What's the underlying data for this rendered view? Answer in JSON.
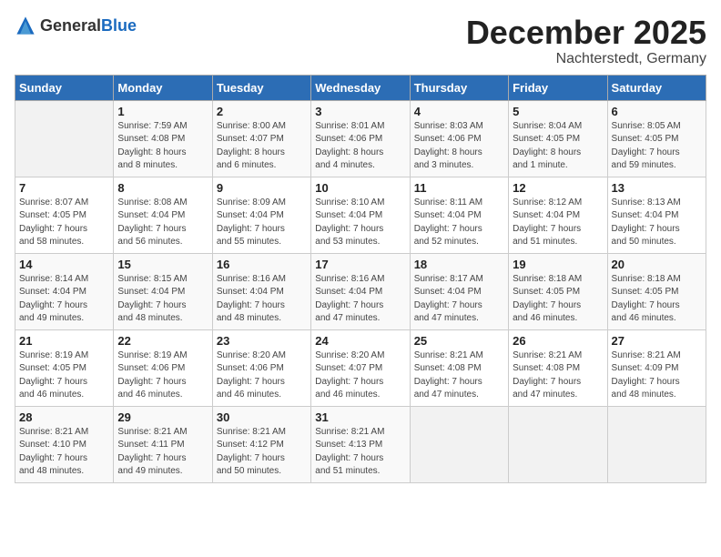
{
  "header": {
    "logo_general": "General",
    "logo_blue": "Blue",
    "month": "December 2025",
    "location": "Nachterstedt, Germany"
  },
  "calendar": {
    "days_of_week": [
      "Sunday",
      "Monday",
      "Tuesday",
      "Wednesday",
      "Thursday",
      "Friday",
      "Saturday"
    ],
    "weeks": [
      [
        {
          "day": "",
          "info": ""
        },
        {
          "day": "1",
          "info": "Sunrise: 7:59 AM\nSunset: 4:08 PM\nDaylight: 8 hours\nand 8 minutes."
        },
        {
          "day": "2",
          "info": "Sunrise: 8:00 AM\nSunset: 4:07 PM\nDaylight: 8 hours\nand 6 minutes."
        },
        {
          "day": "3",
          "info": "Sunrise: 8:01 AM\nSunset: 4:06 PM\nDaylight: 8 hours\nand 4 minutes."
        },
        {
          "day": "4",
          "info": "Sunrise: 8:03 AM\nSunset: 4:06 PM\nDaylight: 8 hours\nand 3 minutes."
        },
        {
          "day": "5",
          "info": "Sunrise: 8:04 AM\nSunset: 4:05 PM\nDaylight: 8 hours\nand 1 minute."
        },
        {
          "day": "6",
          "info": "Sunrise: 8:05 AM\nSunset: 4:05 PM\nDaylight: 7 hours\nand 59 minutes."
        }
      ],
      [
        {
          "day": "7",
          "info": "Sunrise: 8:07 AM\nSunset: 4:05 PM\nDaylight: 7 hours\nand 58 minutes."
        },
        {
          "day": "8",
          "info": "Sunrise: 8:08 AM\nSunset: 4:04 PM\nDaylight: 7 hours\nand 56 minutes."
        },
        {
          "day": "9",
          "info": "Sunrise: 8:09 AM\nSunset: 4:04 PM\nDaylight: 7 hours\nand 55 minutes."
        },
        {
          "day": "10",
          "info": "Sunrise: 8:10 AM\nSunset: 4:04 PM\nDaylight: 7 hours\nand 53 minutes."
        },
        {
          "day": "11",
          "info": "Sunrise: 8:11 AM\nSunset: 4:04 PM\nDaylight: 7 hours\nand 52 minutes."
        },
        {
          "day": "12",
          "info": "Sunrise: 8:12 AM\nSunset: 4:04 PM\nDaylight: 7 hours\nand 51 minutes."
        },
        {
          "day": "13",
          "info": "Sunrise: 8:13 AM\nSunset: 4:04 PM\nDaylight: 7 hours\nand 50 minutes."
        }
      ],
      [
        {
          "day": "14",
          "info": "Sunrise: 8:14 AM\nSunset: 4:04 PM\nDaylight: 7 hours\nand 49 minutes."
        },
        {
          "day": "15",
          "info": "Sunrise: 8:15 AM\nSunset: 4:04 PM\nDaylight: 7 hours\nand 48 minutes."
        },
        {
          "day": "16",
          "info": "Sunrise: 8:16 AM\nSunset: 4:04 PM\nDaylight: 7 hours\nand 48 minutes."
        },
        {
          "day": "17",
          "info": "Sunrise: 8:16 AM\nSunset: 4:04 PM\nDaylight: 7 hours\nand 47 minutes."
        },
        {
          "day": "18",
          "info": "Sunrise: 8:17 AM\nSunset: 4:04 PM\nDaylight: 7 hours\nand 47 minutes."
        },
        {
          "day": "19",
          "info": "Sunrise: 8:18 AM\nSunset: 4:05 PM\nDaylight: 7 hours\nand 46 minutes."
        },
        {
          "day": "20",
          "info": "Sunrise: 8:18 AM\nSunset: 4:05 PM\nDaylight: 7 hours\nand 46 minutes."
        }
      ],
      [
        {
          "day": "21",
          "info": "Sunrise: 8:19 AM\nSunset: 4:05 PM\nDaylight: 7 hours\nand 46 minutes."
        },
        {
          "day": "22",
          "info": "Sunrise: 8:19 AM\nSunset: 4:06 PM\nDaylight: 7 hours\nand 46 minutes."
        },
        {
          "day": "23",
          "info": "Sunrise: 8:20 AM\nSunset: 4:06 PM\nDaylight: 7 hours\nand 46 minutes."
        },
        {
          "day": "24",
          "info": "Sunrise: 8:20 AM\nSunset: 4:07 PM\nDaylight: 7 hours\nand 46 minutes."
        },
        {
          "day": "25",
          "info": "Sunrise: 8:21 AM\nSunset: 4:08 PM\nDaylight: 7 hours\nand 47 minutes."
        },
        {
          "day": "26",
          "info": "Sunrise: 8:21 AM\nSunset: 4:08 PM\nDaylight: 7 hours\nand 47 minutes."
        },
        {
          "day": "27",
          "info": "Sunrise: 8:21 AM\nSunset: 4:09 PM\nDaylight: 7 hours\nand 48 minutes."
        }
      ],
      [
        {
          "day": "28",
          "info": "Sunrise: 8:21 AM\nSunset: 4:10 PM\nDaylight: 7 hours\nand 48 minutes."
        },
        {
          "day": "29",
          "info": "Sunrise: 8:21 AM\nSunset: 4:11 PM\nDaylight: 7 hours\nand 49 minutes."
        },
        {
          "day": "30",
          "info": "Sunrise: 8:21 AM\nSunset: 4:12 PM\nDaylight: 7 hours\nand 50 minutes."
        },
        {
          "day": "31",
          "info": "Sunrise: 8:21 AM\nSunset: 4:13 PM\nDaylight: 7 hours\nand 51 minutes."
        },
        {
          "day": "",
          "info": ""
        },
        {
          "day": "",
          "info": ""
        },
        {
          "day": "",
          "info": ""
        }
      ]
    ]
  }
}
